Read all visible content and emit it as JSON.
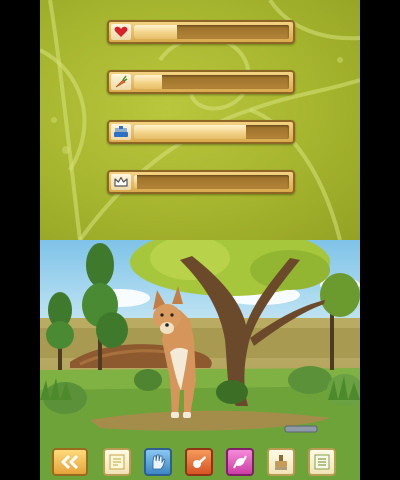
{
  "stats": [
    {
      "icon": "heart-icon",
      "level": 0.28,
      "color": "#d8222b"
    },
    {
      "icon": "carrot-icon",
      "level": 0.18,
      "color": "#e86d2a"
    },
    {
      "icon": "brush-icon",
      "level": 0.72,
      "color": "#2d71c7"
    },
    {
      "icon": "crown-icon",
      "level": 0.02,
      "color": "#555555"
    }
  ],
  "toolbar": [
    {
      "icon": "back-arrow-icon"
    },
    {
      "icon": "notes-icon"
    },
    {
      "icon": "glove-icon"
    },
    {
      "icon": "whistle-icon"
    },
    {
      "icon": "treat-icon"
    },
    {
      "icon": "brush-icon"
    },
    {
      "icon": "menu-list-icon"
    }
  ],
  "colors": {
    "top_background": "#a6b52e",
    "bar_frame": "#d9a94c",
    "bar_fill": "#f3d389",
    "grass": "#6ea33a",
    "dingo_fur": "#d6955a"
  }
}
